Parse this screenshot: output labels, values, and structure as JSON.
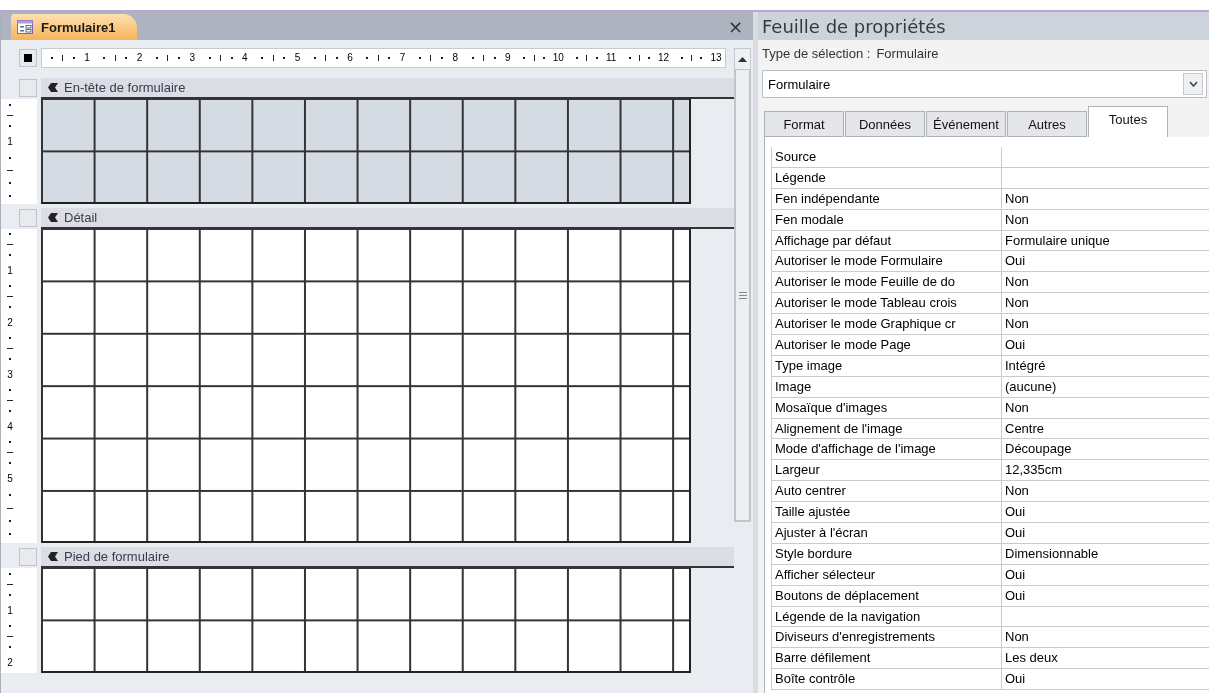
{
  "document_tab": {
    "title": "Formulaire1"
  },
  "close_label": "×",
  "ruler": {
    "marks": [
      "1",
      "2",
      "3",
      "4",
      "5",
      "6",
      "7",
      "8",
      "9",
      "10",
      "11",
      "12",
      "13"
    ]
  },
  "sections": [
    {
      "title": "En-tête de formulaire",
      "shaded": true,
      "ruler_marks": [
        "1"
      ]
    },
    {
      "title": "Détail",
      "shaded": false,
      "ruler_marks": [
        "1",
        "2",
        "3",
        "4",
        "5"
      ]
    },
    {
      "title": "Pied de formulaire",
      "shaded": false,
      "ruler_marks": [
        "1",
        "2"
      ]
    }
  ],
  "property_sheet": {
    "title": "Feuille de propriétés",
    "selection_type_label": "Type de sélection :",
    "selection_type": "Formulaire",
    "object": "Formulaire",
    "tabs": [
      {
        "label": "Format",
        "selected": false
      },
      {
        "label": "Données",
        "selected": false
      },
      {
        "label": "Événement",
        "selected": false
      },
      {
        "label": "Autres",
        "selected": false
      },
      {
        "label": "Toutes",
        "selected": true
      }
    ],
    "properties": [
      {
        "name": "Source"
      },
      {
        "name": "Légende"
      },
      {
        "name": "Fen indépendante",
        "value": "Non"
      },
      {
        "name": "Fen modale",
        "value": "Non"
      },
      {
        "name": "Affichage par défaut",
        "value": "Formulaire unique"
      },
      {
        "name": "Autoriser le mode Formulaire",
        "value": "Oui"
      },
      {
        "name": "Autoriser le mode Feuille de do",
        "value": "Non"
      },
      {
        "name": "Autoriser le mode Tableau crois",
        "value": "Non"
      },
      {
        "name": "Autoriser le mode Graphique cr",
        "value": "Non"
      },
      {
        "name": "Autoriser le mode Page",
        "value": "Oui"
      },
      {
        "name": "Type image",
        "value": "Intégré"
      },
      {
        "name": "Image",
        "value": "(aucune)"
      },
      {
        "name": "Mosaïque d'images",
        "value": "Non"
      },
      {
        "name": "Alignement de l'image",
        "value": "Centre"
      },
      {
        "name": "Mode d'affichage de l'image",
        "value": "Découpage"
      },
      {
        "name": "Largeur",
        "value": "12,335cm"
      },
      {
        "name": "Auto centrer",
        "value": "Non"
      },
      {
        "name": "Taille ajustée",
        "value": "Oui"
      },
      {
        "name": "Ajuster à l'écran",
        "value": "Oui"
      },
      {
        "name": "Style bordure",
        "value": "Dimensionnable"
      },
      {
        "name": "Afficher sélecteur",
        "value": "Oui"
      },
      {
        "name": "Boutons de déplacement",
        "value": "Oui"
      },
      {
        "name": "Légende de la navigation"
      },
      {
        "name": "Diviseurs d'enregistrements",
        "value": "Non"
      },
      {
        "name": "Barre défilement",
        "value": "Les deux"
      },
      {
        "name": "Boîte contrôle",
        "value": "Oui"
      }
    ]
  }
}
